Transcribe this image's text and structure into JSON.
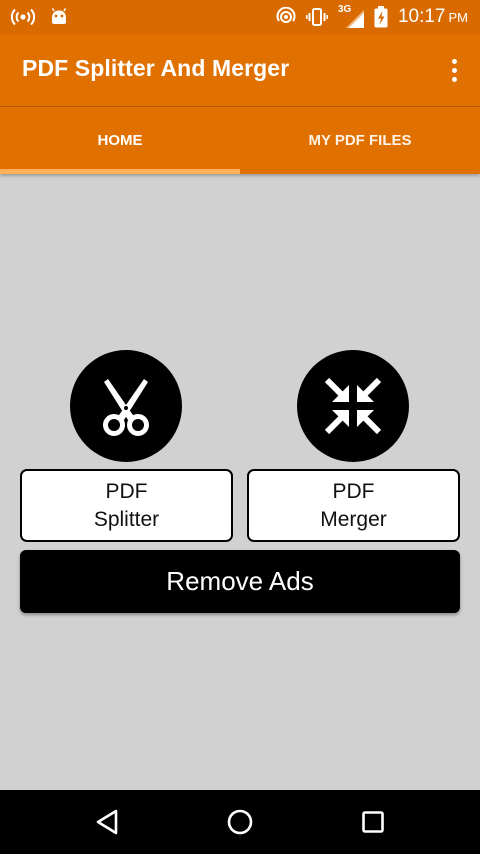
{
  "status_bar": {
    "time": "10:17",
    "ampm": "PM",
    "network_label": "3G",
    "icons_left": [
      "hotspot-icon",
      "android-icon"
    ],
    "icons_right": [
      "wifi-calling-icon",
      "vibrate-icon",
      "signal-icon",
      "battery-charging-icon"
    ]
  },
  "app_bar": {
    "title": "PDF Splitter And Merger",
    "overflow_icon": "more-vert-icon"
  },
  "tabs": [
    {
      "label": "HOME",
      "selected": true
    },
    {
      "label": "MY PDF FILES",
      "selected": false
    }
  ],
  "features": {
    "splitter": {
      "icon": "scissors-icon",
      "line1": "PDF",
      "line2": "Splitter"
    },
    "merger": {
      "icon": "merge-arrows-icon",
      "line1": "PDF",
      "line2": "Merger"
    }
  },
  "remove_ads_label": "Remove Ads",
  "nav_bar": {
    "icons": [
      "back-icon",
      "home-icon",
      "recents-icon"
    ]
  },
  "colors": {
    "status_bar": "#d86a00",
    "app_bar": "#e07000",
    "tab_indicator": "#ffb15c",
    "background": "#d1d1d1",
    "icon_circle": "#000000"
  }
}
